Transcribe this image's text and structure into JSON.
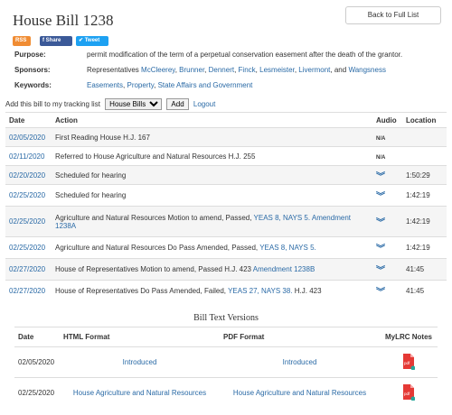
{
  "bill": {
    "title": "House Bill 1238",
    "back_label": "Back to Full List",
    "share": {
      "rss": "RSS",
      "facebook": "f Share",
      "twitter": "✔ Tweet"
    },
    "purpose_label": "Purpose:",
    "purpose": "permit modification of the term of a perpetual conservation easement after the death of the grantor.",
    "sponsors_label": "Sponsors:",
    "sponsors_prefix": "Representatives",
    "sponsors": [
      "McCleerey",
      "Brunner",
      "Dennert",
      "Finck",
      "Lesmeister",
      "Livermont",
      "Wangsness"
    ],
    "sponsors_and": "and",
    "keywords_label": "Keywords:",
    "keywords": [
      "Easements",
      "Property",
      "State Affairs and Government"
    ]
  },
  "tracking": {
    "label": "Add this bill to my tracking list",
    "selected": "House Bills",
    "add_label": "Add",
    "logout_label": "Logout"
  },
  "actions_table": {
    "headers": {
      "date": "Date",
      "action": "Action",
      "audio": "Audio",
      "location": "Location"
    },
    "rows": [
      {
        "date": "02/05/2020",
        "text": "First Reading House H.J. 167",
        "audio": "N/A",
        "location": ""
      },
      {
        "date": "02/11/2020",
        "text": "Referred to House Agriculture and Natural Resources H.J. 255",
        "audio": "N/A",
        "location": ""
      },
      {
        "date": "02/20/2020",
        "text": "Scheduled for hearing",
        "audio": "chevron",
        "location": "1:50:29"
      },
      {
        "date": "02/25/2020",
        "text": "Scheduled for hearing",
        "audio": "chevron",
        "location": "1:42:19"
      },
      {
        "date": "02/25/2020",
        "text": "Agriculture and Natural Resources Motion to amend, Passed,",
        "link1": "YEAS 8, NAYS 5.",
        "link2": "Amendment",
        "text_line2": "1238A",
        "audio": "chevron",
        "location": "1:42:19"
      },
      {
        "date": "02/25/2020",
        "text": "Agriculture and Natural Resources Do Pass Amended, Passed,",
        "link1": "YEAS 8, NAYS 5.",
        "audio": "chevron",
        "location": "1:42:19"
      },
      {
        "date": "02/27/2020",
        "text": "House of Representatives Motion to amend, Passed H.J. 423",
        "link1": "Amendment 1238B",
        "audio": "chevron",
        "location": "41:45"
      },
      {
        "date": "02/27/2020",
        "text": "House of Representatives Do Pass Amended, Failed,",
        "link1": "YEAS 27, NAYS 38.",
        "text_after": "H.J. 423",
        "audio": "chevron",
        "location": "41:45"
      }
    ]
  },
  "versions": {
    "heading": "Bill Text Versions",
    "headers": {
      "date": "Date",
      "html": "HTML Format",
      "pdf": "PDF Format",
      "notes": "MyLRC Notes"
    },
    "rows": [
      {
        "date": "02/05/2020",
        "html": "Introduced",
        "pdf": "Introduced"
      },
      {
        "date": "02/25/2020",
        "html": "House Agriculture and Natural Resources",
        "pdf": "House Agriculture and Natural Resources"
      }
    ],
    "pdf_icon_text": "pdf"
  },
  "colors": {
    "link": "#2a6aa6",
    "rss": "#f08c33",
    "facebook": "#3b5998",
    "twitter": "#1da1f2",
    "pdf_red": "#e53935",
    "pdf_teal": "#26a69a"
  }
}
